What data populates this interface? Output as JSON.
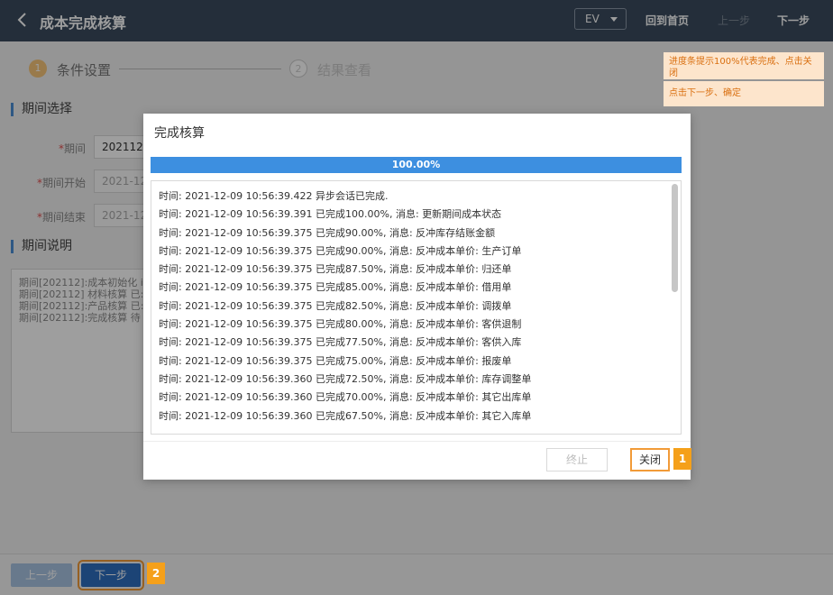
{
  "header": {
    "title": "成本完成核算",
    "ev_label": "EV",
    "nav_home": "回到首页",
    "nav_prev": "上一步",
    "nav_next": "下一步"
  },
  "steps": [
    {
      "number": "1",
      "label": "条件设置"
    },
    {
      "number": "2",
      "label": "结果查看"
    }
  ],
  "period_section": {
    "title": "期间选择",
    "fields": [
      {
        "label": "期间",
        "value": "202112"
      },
      {
        "label": "期间开始",
        "value": "2021-12-"
      },
      {
        "label": "期间结束",
        "value": "2021-12-"
      }
    ]
  },
  "desc_section": {
    "title": "期间说明",
    "lines": [
      "期间[202112]:成本初始化 i",
      "期间[202112] 材料核算 已:",
      "期间[202112]:产品核算 已:",
      "期间[202112]:完成核算 待"
    ]
  },
  "footer": {
    "prev_label": "上一步",
    "next_label": "下一步"
  },
  "modal": {
    "title": "完成核算",
    "progress_text": "100.00%",
    "progress_value": 100,
    "log_lines": [
      "时间: 2021-12-09 10:56:39.422 异步会话已完成.",
      "时间: 2021-12-09 10:56:39.391 已完成100.00%, 消息: 更新期间成本状态",
      "时间: 2021-12-09 10:56:39.375 已完成90.00%, 消息: 反冲库存结账金额",
      "时间: 2021-12-09 10:56:39.375 已完成90.00%, 消息: 反冲成本单价: 生产订单",
      "时间: 2021-12-09 10:56:39.375 已完成87.50%, 消息: 反冲成本单价: 归还单",
      "时间: 2021-12-09 10:56:39.375 已完成85.00%, 消息: 反冲成本单价: 借用单",
      "时间: 2021-12-09 10:56:39.375 已完成82.50%, 消息: 反冲成本单价: 调拨单",
      "时间: 2021-12-09 10:56:39.375 已完成80.00%, 消息: 反冲成本单价: 客供退制",
      "时间: 2021-12-09 10:56:39.375 已完成77.50%, 消息: 反冲成本单价: 客供入库",
      "时间: 2021-12-09 10:56:39.375 已完成75.00%, 消息: 反冲成本单价: 报废单",
      "时间: 2021-12-09 10:56:39.360 已完成72.50%, 消息: 反冲成本单价: 库存调整单",
      "时间: 2021-12-09 10:56:39.360 已完成70.00%, 消息: 反冲成本单价: 其它出库单",
      "时间: 2021-12-09 10:56:39.360 已完成67.50%, 消息: 反冲成本单价: 其它入库单"
    ],
    "stop_label": "终止",
    "close_label": "关闭"
  },
  "annotations": {
    "notes": [
      {
        "number": "1",
        "text": "进度条提示100%代表完成、点击关闭"
      },
      {
        "number": "2",
        "text": "点击下一步、确定"
      }
    ],
    "close_badge": "1",
    "next_badge": "2"
  },
  "colors": {
    "header_bg": "#3a4b5e",
    "primary": "#2e6fbf",
    "progress": "#3d8fe0",
    "annotation": "#f5a01a",
    "annotation_note_bg": "#fde5cc"
  }
}
